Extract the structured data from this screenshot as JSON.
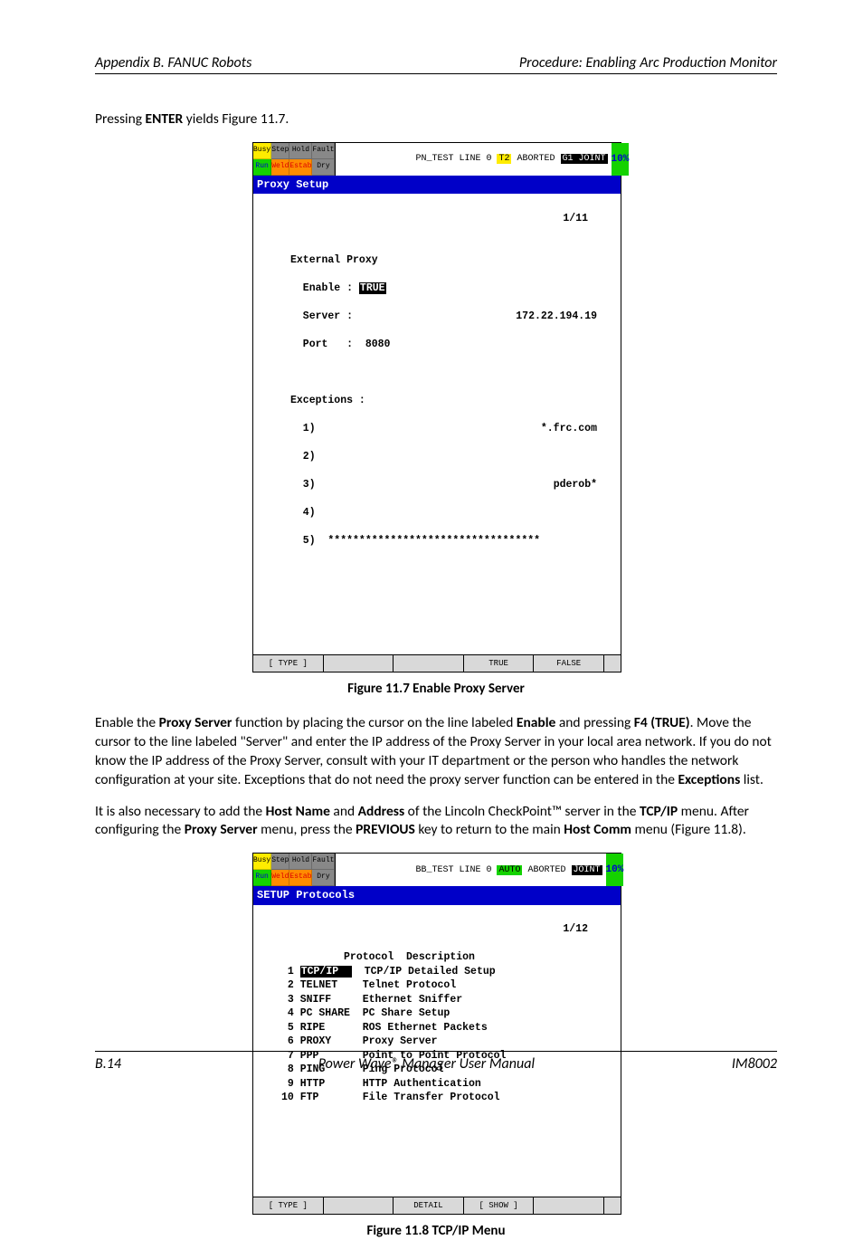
{
  "header": {
    "left": "Appendix B. FANUC Robots",
    "right": "Procedure: Enabling Arc Production Monitor"
  },
  "para1": {
    "t1": "Pressing ",
    "b1": "ENTER",
    "t2": " yields Figure 11.7."
  },
  "fig1": {
    "caption": "Figure 11.7   Enable Proxy Server",
    "status": {
      "busy": "Busy",
      "step": "Step",
      "hold": "Hold",
      "fault": "Fault",
      "run": "Run",
      "weld": "Weld",
      "estab": "Estab",
      "dry": "Dry"
    },
    "msg": {
      "pre": "PN_TEST LINE 0 ",
      "t2": "T2",
      "mid": " ABORTED ",
      "g1": "G1 JOINT"
    },
    "pct": "10%",
    "title": "Proxy Setup",
    "counter": "1/11",
    "lines": {
      "ext": "External Proxy",
      "enable_l": "  Enable : ",
      "enable_v": "TRUE",
      "server_l": "  Server :",
      "server_v": "172.22.194.19",
      "port_l": "  Port   :  8080",
      "except": "Exceptions :",
      "e1_l": "  1)",
      "e1_v": "*.frc.com",
      "e2_l": "  2)",
      "e2_v": "",
      "e3_l": "  3)",
      "e3_v": "pderob*",
      "e4_l": "  4)",
      "e4_v": "",
      "e5_l": "  5)  **********************************"
    },
    "softkeys": {
      "k1": "[ TYPE ]",
      "k2": "",
      "k3": "",
      "k4": "TRUE",
      "k5": "FALSE"
    }
  },
  "para2": {
    "t1": "Enable the ",
    "b1": "Proxy Server",
    "t2": " function by placing the cursor on the line labeled ",
    "b2": "Enable",
    "t3": " and pressing ",
    "b3": "F4 (TRUE)",
    "t4": ".  Move the cursor to the line labeled \"Server\" and enter the IP address of the Proxy Server in your local area network.  If you do not know the IP address of the Proxy Server, consult with your IT department or the person who handles the network configuration at your site.  Exceptions that do not need the proxy server function can be entered in the ",
    "b4": "Exceptions",
    "t5": " list."
  },
  "para3": {
    "t1": "It is also necessary to add the ",
    "b1": "Host Name",
    "t2": " and ",
    "b2": "Address",
    "t3": " of the Lincoln CheckPoint™ server in the ",
    "b3": "TCP/IP",
    "t4": " menu.  After configuring the ",
    "b4": "Proxy Server",
    "t5": " menu, press the ",
    "b5": "PREVIOUS",
    "t6": " key to return to the main ",
    "b6": "Host Comm",
    "t7": " menu (Figure 11.8)."
  },
  "fig2": {
    "caption": "Figure 11.8   TCP/IP Menu",
    "msg": {
      "pre": "BB_TEST LINE 0 ",
      "auto": "AUTO",
      "mid": " ABORTED ",
      "joint": "JOINT"
    },
    "pct": "10%",
    "title": "SETUP Protocols",
    "counter": "1/12",
    "hdr_proto": "Protocol",
    "hdr_desc": "Description",
    "rows": [
      {
        "n": "1",
        "p": "TCP/IP",
        "d": "TCP/IP Detailed Setup",
        "sel": true
      },
      {
        "n": "2",
        "p": "TELNET",
        "d": "Telnet Protocol"
      },
      {
        "n": "3",
        "p": "SNIFF",
        "d": "Ethernet Sniffer"
      },
      {
        "n": "4",
        "p": "PC SHARE",
        "d": "PC Share Setup"
      },
      {
        "n": "5",
        "p": "RIPE",
        "d": "ROS Ethernet Packets"
      },
      {
        "n": "6",
        "p": "PROXY",
        "d": "Proxy Server"
      },
      {
        "n": "7",
        "p": "PPP",
        "d": "Point to Point Protocol"
      },
      {
        "n": "8",
        "p": "PING",
        "d": "Ping Protocol"
      },
      {
        "n": "9",
        "p": "HTTP",
        "d": "HTTP Authentication"
      },
      {
        "n": "10",
        "p": "FTP",
        "d": "File Transfer Protocol"
      }
    ],
    "softkeys": {
      "k1": "[ TYPE ]",
      "k2": "",
      "k3": "DETAIL",
      "k4": "[ SHOW ]",
      "k5": ""
    }
  },
  "footer": {
    "left": "B.14",
    "center": "Power Wave® Manager User Manual",
    "right": "IM8002"
  }
}
